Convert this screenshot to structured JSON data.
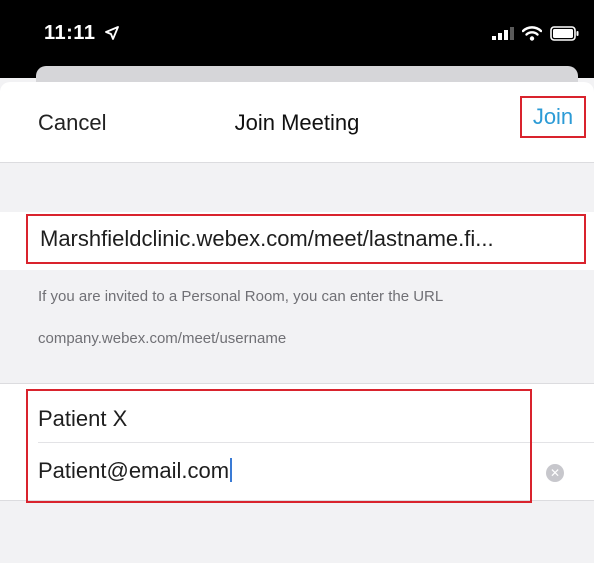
{
  "status_bar": {
    "time": "11:11",
    "location_icon": "location-arrow-icon",
    "signal_icon": "cellular-signal-icon",
    "wifi_icon": "wifi-icon",
    "battery_icon": "battery-icon"
  },
  "nav": {
    "cancel_label": "Cancel",
    "title": "Join Meeting",
    "join_label": "Join"
  },
  "meeting": {
    "url_value": "Marshfieldclinic.webex.com/meet/lastname.fi...",
    "hint_line1": "If you are invited to a Personal Room, you can enter the URL",
    "hint_line2": "company.webex.com/meet/username"
  },
  "user": {
    "name_value": "Patient X",
    "email_value": "Patient@email.com",
    "clear_icon": "clear-x-icon"
  },
  "colors": {
    "accent": "#2c9bd6",
    "highlight": "#d9232d",
    "background": "#f2f2f4"
  }
}
